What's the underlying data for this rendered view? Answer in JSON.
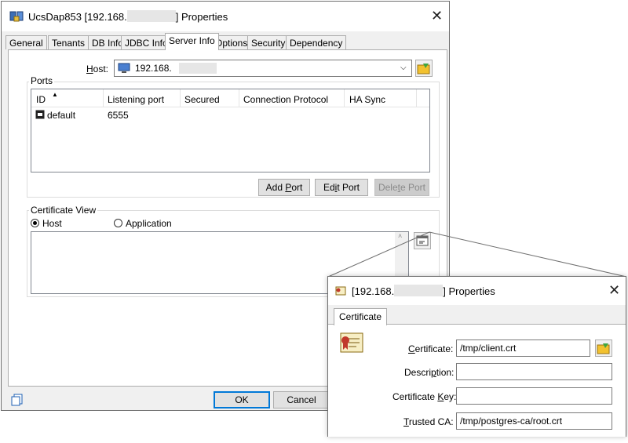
{
  "main": {
    "title_prefix": "UcsDap853 [192.168.",
    "title_suffix": "] Properties",
    "tabs": [
      {
        "label": "General"
      },
      {
        "label": "Tenants"
      },
      {
        "label": "DB Info"
      },
      {
        "label": "JDBC Info"
      },
      {
        "label": "Server Info",
        "active": true
      },
      {
        "label": "Options"
      },
      {
        "label": "Security"
      },
      {
        "label": "Dependency"
      }
    ],
    "host": {
      "label_pre": "",
      "label_key": "H",
      "label_post": "ost:",
      "value_prefix": "192.168."
    },
    "ports": {
      "group_label": "Ports",
      "columns": [
        "ID",
        "Listening port",
        "Secured",
        "Connection Protocol",
        "HA Sync"
      ],
      "rows": [
        {
          "id": "default",
          "listening_port": "6555",
          "secured": "",
          "protocol": "",
          "ha_sync": ""
        }
      ],
      "add_port": {
        "pre": "Add ",
        "key": "P",
        "post": "ort"
      },
      "edit_port": {
        "pre": "Ed",
        "key": "i",
        "post": "t Port"
      },
      "delete_port": {
        "pre": "Dele",
        "key": "t",
        "post": "e Port"
      }
    },
    "certificate_view": {
      "group_label": "Certificate View",
      "radio_host": "Host",
      "radio_application": "Application",
      "selected": "Host"
    },
    "footer": {
      "ok": "OK",
      "cancel": "Cancel"
    }
  },
  "popup": {
    "title_prefix": "[192.168.",
    "title_suffix": "] Properties",
    "tab": "Certificate",
    "fields": [
      {
        "label_pre": "",
        "label_key": "C",
        "label_post": "ertificate:",
        "value": "/tmp/client.crt"
      },
      {
        "label_pre": "Descri",
        "label_key": "p",
        "label_post": "tion:",
        "value": ""
      },
      {
        "label_pre": "Certificate ",
        "label_key": "K",
        "label_post": "ey:",
        "value": ""
      },
      {
        "label_pre": "",
        "label_key": "T",
        "label_post": "rusted CA:",
        "value": "/tmp/postgres-ca/root.crt"
      }
    ]
  },
  "colors": {
    "accent": "#0078d7",
    "button": "#e1e1e1",
    "disabled": "#cccccc"
  }
}
